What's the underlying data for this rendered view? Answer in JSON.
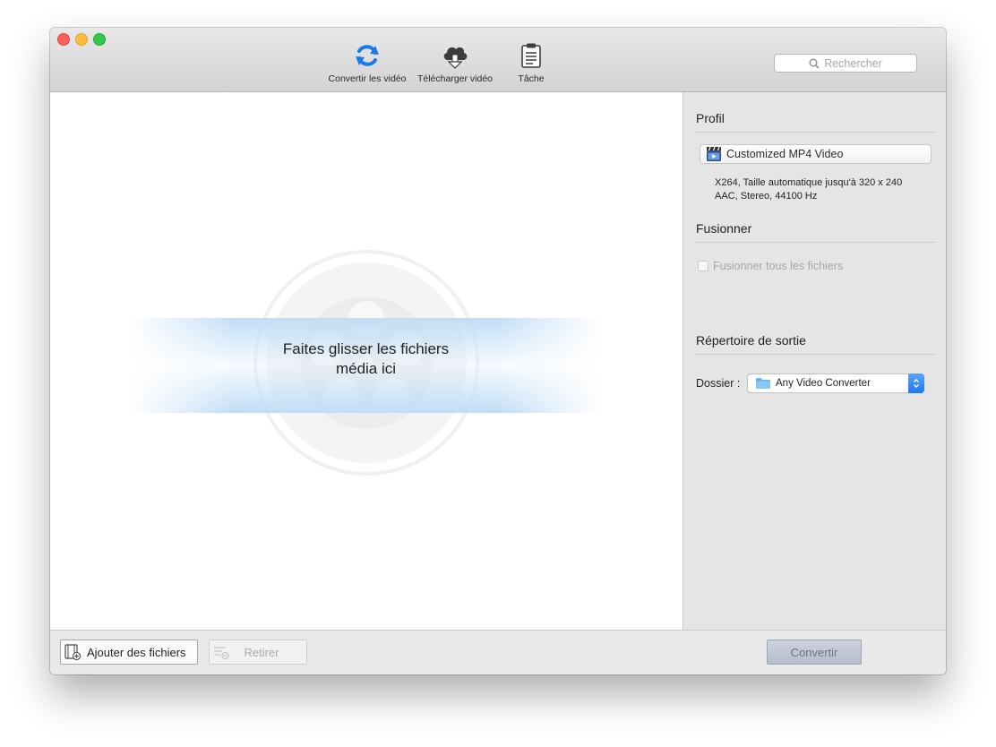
{
  "toolbar": {
    "convert_label": "Convertir les vidéo",
    "download_label": "Télécharger vidéo",
    "task_label": "Tâche"
  },
  "search": {
    "placeholder": "Rechercher"
  },
  "dropzone": {
    "line1": "Faites glisser les fichiers",
    "line2": "média ici"
  },
  "profile": {
    "title": "Profil",
    "selected": "Customized MP4 Video",
    "desc_line1": "X264, Taille automatique jusqu'à 320 x 240",
    "desc_line2": "AAC, Stereo, 44100 Hz"
  },
  "merge": {
    "title": "Fusionner",
    "checkbox_label": "Fusionner tous les fichiers",
    "checked": false
  },
  "output": {
    "title": "Répertoire de sortie",
    "folder_label": "Dossier :",
    "folder_value": "Any Video Converter"
  },
  "bottom": {
    "add_label": "Ajouter des fichiers",
    "remove_label": "Retirer",
    "convert_label": "Convertir"
  },
  "colors": {
    "accent": "#1f77ee",
    "close": "#fc605c",
    "minimize": "#fdbc40",
    "maximize": "#34c84a"
  }
}
